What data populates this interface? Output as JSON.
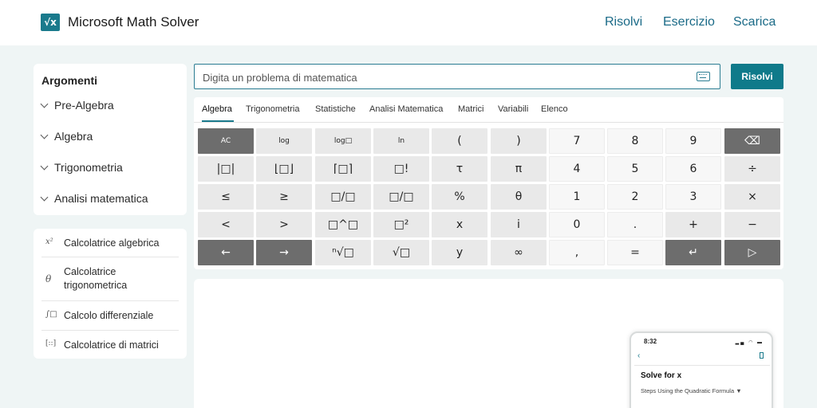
{
  "header": {
    "brand": "Microsoft Math Solver",
    "logo_glyph": "√x",
    "nav": [
      "Risolvi",
      "Esercizio",
      "Scarica"
    ]
  },
  "topics": {
    "title": "Argomenti",
    "items": [
      "Pre-Algebra",
      "Algebra",
      "Trigonometria",
      "Analisi matematica"
    ]
  },
  "calculators": [
    {
      "icon": "x²",
      "label": "Calcolatrice algebrica"
    },
    {
      "icon": "θ",
      "label": "Calcolatrice trigonometrica"
    },
    {
      "icon": "∫□",
      "label": "Calcolo differenziale"
    },
    {
      "icon": "[::]",
      "label": "Calcolatrice di matrici"
    }
  ],
  "search": {
    "placeholder": "Digita un problema di matematica",
    "button": "Risolvi"
  },
  "tabs": [
    "Algebra",
    "Trigonometria",
    "Statistiche",
    "Analisi Matematica",
    "Matrici",
    "Variabili",
    "Elenco"
  ],
  "keys": [
    [
      "AC",
      "log",
      "log□",
      "ln",
      "(",
      ")",
      "7",
      "8",
      "9",
      "⌫"
    ],
    [
      "|□|",
      "⌊□⌋",
      "⌈□⌉",
      "□!",
      "τ",
      "π",
      "4",
      "5",
      "6",
      "÷"
    ],
    [
      "≤",
      "≥",
      "□/□",
      "□/□",
      "%",
      "θ",
      "1",
      "2",
      "3",
      "×"
    ],
    [
      "<",
      ">",
      "□^□",
      "□²",
      "x",
      "i",
      "0",
      ".",
      "+",
      "−"
    ],
    [
      "←",
      "→",
      "ⁿ√□",
      "√□",
      "y",
      "∞",
      ",",
      "=",
      "↵",
      "▷"
    ]
  ],
  "phone": {
    "time": "8:32",
    "title": "Solve for x",
    "subtitle": "Steps Using the Quadratic Formula ▼"
  },
  "colors": {
    "accent": "#0f7a8a",
    "nav_link": "#1a6a87",
    "dark_key": "#6d6d6d"
  }
}
